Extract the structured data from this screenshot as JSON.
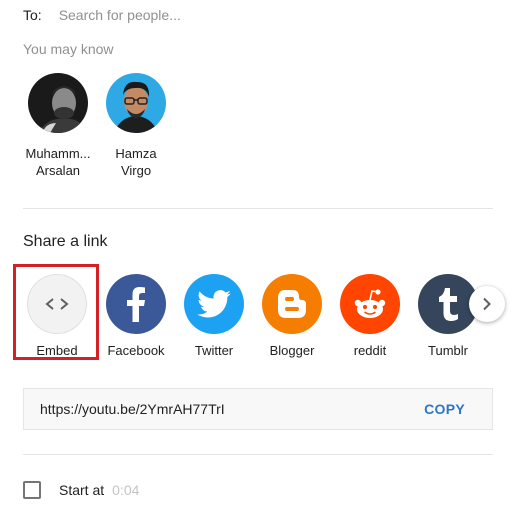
{
  "to": {
    "label": "To:",
    "placeholder": "Search for people..."
  },
  "you_may_know": {
    "heading": "You may know",
    "people": [
      {
        "name_line1": "Muhamm...",
        "name_line2": "Arsalan"
      },
      {
        "name_line1": "Hamza",
        "name_line2": "Virgo"
      }
    ]
  },
  "share": {
    "heading": "Share a link",
    "targets": [
      {
        "label": "Embed",
        "icon": "embed-code-icon",
        "color": "#f2f2f2"
      },
      {
        "label": "Facebook",
        "icon": "facebook-icon",
        "color": "#3b5998"
      },
      {
        "label": "Twitter",
        "icon": "twitter-icon",
        "color": "#1da1f2"
      },
      {
        "label": "Blogger",
        "icon": "blogger-icon",
        "color": "#f57d00"
      },
      {
        "label": "reddit",
        "icon": "reddit-icon",
        "color": "#ff4500"
      },
      {
        "label": "Tumblr",
        "icon": "tumblr-icon",
        "color": "#35465c"
      }
    ],
    "next_icon": "chevron-right-icon"
  },
  "link": {
    "url": "https://youtu.be/2YmrAH77TrI",
    "copy_label": "COPY"
  },
  "start_at": {
    "label": "Start at",
    "time": "0:04",
    "checked": false
  },
  "colors": {
    "highlight": "#d62027",
    "copy": "#2b77c4",
    "muted_text": "#909090"
  }
}
